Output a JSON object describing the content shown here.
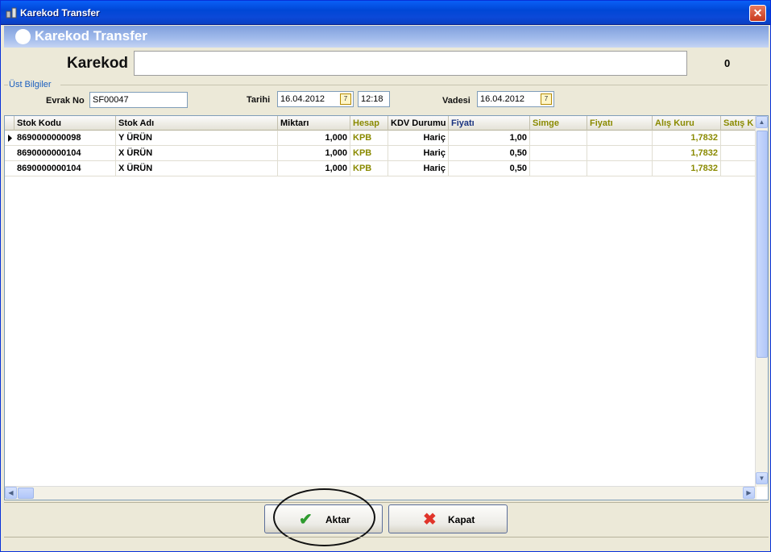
{
  "window": {
    "title": "Karekod Transfer",
    "close_glyph": "✕"
  },
  "header": {
    "title": "Karekod Transfer"
  },
  "karekod": {
    "label": "Karekod",
    "value": "",
    "count": "0"
  },
  "ust_bilgiler": {
    "section_title": "Üst Bilgiler",
    "evrak_no_label": "Evrak No",
    "evrak_no_value": "SF00047",
    "tarihi_label": "Tarihi",
    "tarihi_value": "16.04.2012",
    "saat_value": "12:18",
    "vadesi_label": "Vadesi",
    "vadesi_value": "16.04.2012",
    "calendar_glyph": "7"
  },
  "grid": {
    "columns": [
      "Stok Kodu",
      "Stok Adı",
      "Miktarı",
      "Hesap",
      "KDV Durumu",
      "Fiyatı",
      "Simge",
      "Fiyatı",
      "Alış Kuru",
      "Satış K"
    ],
    "rows": [
      {
        "stok_kodu": "8690000000098",
        "stok_adi": "Y ÜRÜN",
        "miktar": "1,000",
        "hesap": "KPB",
        "kdv": "Hariç",
        "fiyat": "1,00",
        "simge": "",
        "fiyat2": "",
        "alis_kuru": "1,7832",
        "satis_kuru": ""
      },
      {
        "stok_kodu": "8690000000104",
        "stok_adi": "X ÜRÜN",
        "miktar": "1,000",
        "hesap": "KPB",
        "kdv": "Hariç",
        "fiyat": "0,50",
        "simge": "",
        "fiyat2": "",
        "alis_kuru": "1,7832",
        "satis_kuru": ""
      },
      {
        "stok_kodu": "8690000000104",
        "stok_adi": "X ÜRÜN",
        "miktar": "1,000",
        "hesap": "KPB",
        "kdv": "Hariç",
        "fiyat": "0,50",
        "simge": "",
        "fiyat2": "",
        "alis_kuru": "1,7832",
        "satis_kuru": ""
      }
    ]
  },
  "buttons": {
    "aktar_label": "Aktar",
    "aktar_icon": "✔",
    "kapat_label": "Kapat",
    "kapat_icon": "✖"
  },
  "colors": {
    "accent_blue": "#0a5ff7",
    "olive_text": "#8a8a00",
    "check_green": "#2e9b2e",
    "kapat_red": "#e0342a"
  }
}
